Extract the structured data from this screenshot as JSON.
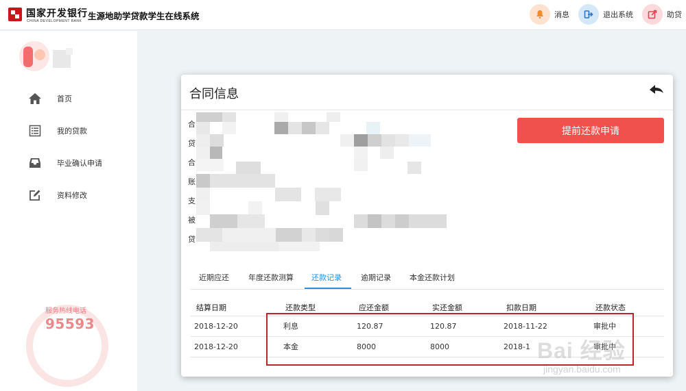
{
  "header": {
    "bank_name_cn": "国家开发银行",
    "bank_name_en": "CHINA DEVELOPMENT BANK",
    "system_title": "生源地助学贷款学生在线系统",
    "buttons": [
      {
        "label": "消息",
        "icon": "bell-icon",
        "color": "#f08b2c"
      },
      {
        "label": "退出系统",
        "icon": "logout-icon",
        "color": "#2a76c9"
      },
      {
        "label": "助贷",
        "icon": "external-link-icon",
        "color": "#e14654"
      }
    ]
  },
  "sidebar": {
    "items": [
      {
        "label": "首页",
        "icon": "home-icon"
      },
      {
        "label": "我的贷款",
        "icon": "list-icon"
      },
      {
        "label": "毕业确认申请",
        "icon": "inbox-icon"
      },
      {
        "label": "资料修改",
        "icon": "edit-icon"
      }
    ],
    "hotline": {
      "label": "服务热线电话",
      "number": "95593"
    }
  },
  "modal": {
    "title": "合同信息",
    "back_icon": "back-arrow-icon",
    "apply_button": "提前还款申请",
    "info_labels": [
      "合",
      "贷",
      "合",
      "账",
      "支",
      "被",
      "贷"
    ],
    "tabs": [
      {
        "label": "近期应还",
        "active": false
      },
      {
        "label": "年度还款测算",
        "active": false
      },
      {
        "label": "还款记录",
        "active": true
      },
      {
        "label": "逾期记录",
        "active": false
      },
      {
        "label": "本金还款计划",
        "active": false
      }
    ],
    "table": {
      "columns": [
        "结算日期",
        "还款类型",
        "应还金额",
        "实还金额",
        "扣款日期",
        "还款状态"
      ],
      "rows": [
        [
          "2018-12-20",
          "利息",
          "120.87",
          "120.87",
          "2018-11-22",
          "审批中"
        ],
        [
          "2018-12-20",
          "本金",
          "8000",
          "8000",
          "2018-1",
          "审批中"
        ]
      ]
    }
  },
  "watermark": {
    "text": "Bai 经验",
    "sub": "jingyan.baidu.com"
  },
  "colors": {
    "accent": "#2a8fd8",
    "danger": "#f0514d",
    "highlight": "#b7262b"
  }
}
